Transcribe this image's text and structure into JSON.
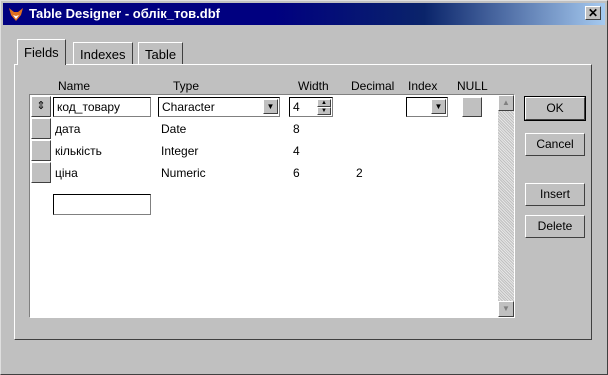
{
  "window": {
    "title": "Table Designer - облік_тов.dbf",
    "close_glyph": "✕"
  },
  "tabs": [
    {
      "label": "Fields"
    },
    {
      "label": "Indexes"
    },
    {
      "label": "Table"
    }
  ],
  "columns": {
    "name": "Name",
    "type": "Type",
    "width": "Width",
    "decimal": "Decimal",
    "index": "Index",
    "null": "NULL"
  },
  "fields": [
    {
      "name": "код_товару",
      "type": "Character",
      "width": "4",
      "decimal": "",
      "current": true
    },
    {
      "name": "дата",
      "type": "Date",
      "width": "8",
      "decimal": ""
    },
    {
      "name": "кількість",
      "type": "Integer",
      "width": "4",
      "decimal": ""
    },
    {
      "name": "ціна",
      "type": "Numeric",
      "width": "6",
      "decimal": "2"
    }
  ],
  "new_field": {
    "name": ""
  },
  "buttons": {
    "ok": "OK",
    "cancel": "Cancel",
    "insert": "Insert",
    "delete": "Delete"
  },
  "icons": {
    "title": "fox-icon",
    "move_row": "updown-arrows-icon"
  },
  "colors": {
    "titlebar": "#000080",
    "face": "#c0c0c0"
  }
}
